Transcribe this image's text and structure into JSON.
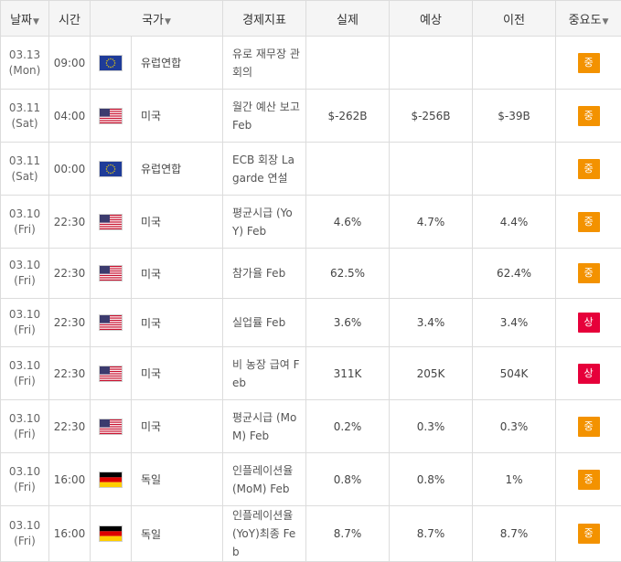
{
  "headers": {
    "date": "날짜",
    "time": "시간",
    "country": "국가",
    "indicator": "경제지표",
    "actual": "실제",
    "forecast": "예상",
    "previous": "이전",
    "importance": "중요도",
    "sort_arrow": "▼"
  },
  "colors": {
    "medium": "#f39200",
    "high": "#e6003a"
  },
  "rows": [
    {
      "date": "03.13",
      "day": "(Mon)",
      "time": "09:00",
      "flag": "eu-flag-icon",
      "country": "유럽연합",
      "indicator": "유로 재무장 관회의",
      "actual": "",
      "forecast": "",
      "previous": "",
      "importance": "중",
      "level": "medium"
    },
    {
      "date": "03.11",
      "day": "(Sat)",
      "time": "04:00",
      "flag": "us-flag-icon",
      "country": "미국",
      "indicator": "월간 예산 보고 Feb",
      "actual": "$-262B",
      "forecast": "$-256B",
      "previous": "$-39B",
      "importance": "중",
      "level": "medium"
    },
    {
      "date": "03.11",
      "day": "(Sat)",
      "time": "00:00",
      "flag": "eu-flag-icon",
      "country": "유럽연합",
      "indicator": "ECB 회장 Lagarde 연설",
      "actual": "",
      "forecast": "",
      "previous": "",
      "importance": "중",
      "level": "medium"
    },
    {
      "date": "03.10",
      "day": "(Fri)",
      "time": "22:30",
      "flag": "us-flag-icon",
      "country": "미국",
      "indicator": "평균시급 (YoY) Feb",
      "actual": "4.6%",
      "forecast": "4.7%",
      "previous": "4.4%",
      "importance": "중",
      "level": "medium"
    },
    {
      "date": "03.10",
      "day": "(Fri)",
      "time": "22:30",
      "flag": "us-flag-icon",
      "country": "미국",
      "indicator": "참가율 Feb",
      "actual": "62.5%",
      "forecast": "",
      "previous": "62.4%",
      "importance": "중",
      "level": "medium"
    },
    {
      "date": "03.10",
      "day": "(Fri)",
      "time": "22:30",
      "flag": "us-flag-icon",
      "country": "미국",
      "indicator": "실업률 Feb",
      "actual": "3.6%",
      "forecast": "3.4%",
      "previous": "3.4%",
      "importance": "상",
      "level": "high"
    },
    {
      "date": "03.10",
      "day": "(Fri)",
      "time": "22:30",
      "flag": "us-flag-icon",
      "country": "미국",
      "indicator": "비 농장 급여 Feb",
      "actual": "311K",
      "forecast": "205K",
      "previous": "504K",
      "importance": "상",
      "level": "high"
    },
    {
      "date": "03.10",
      "day": "(Fri)",
      "time": "22:30",
      "flag": "us-flag-icon",
      "country": "미국",
      "indicator": "평균시급 (MoM) Feb",
      "actual": "0.2%",
      "forecast": "0.3%",
      "previous": "0.3%",
      "importance": "중",
      "level": "medium"
    },
    {
      "date": "03.10",
      "day": "(Fri)",
      "time": "16:00",
      "flag": "de-flag-icon",
      "country": "독일",
      "indicator": "인플레이션율 (MoM) Feb",
      "actual": "0.8%",
      "forecast": "0.8%",
      "previous": "1%",
      "importance": "중",
      "level": "medium"
    },
    {
      "date": "03.10",
      "day": "(Fri)",
      "time": "16:00",
      "flag": "de-flag-icon",
      "country": "독일",
      "indicator": "인플레이션율 (YoY)최종 Feb",
      "actual": "8.7%",
      "forecast": "8.7%",
      "previous": "8.7%",
      "importance": "중",
      "level": "medium"
    }
  ]
}
